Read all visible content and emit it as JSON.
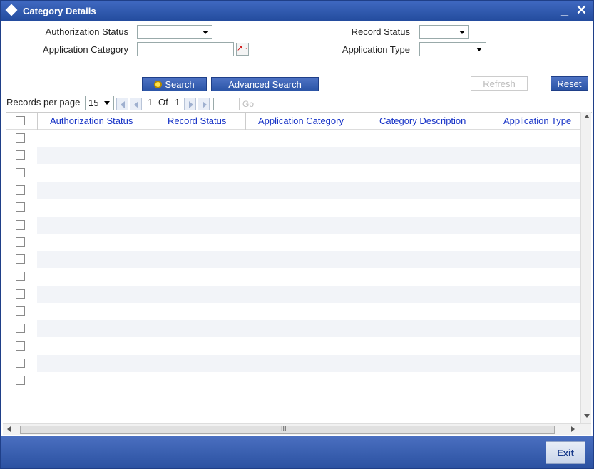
{
  "window": {
    "title": "Category Details",
    "minimize_glyph": "_",
    "close_glyph": "✕"
  },
  "form": {
    "authorization_status": {
      "label": "Authorization Status",
      "value": ""
    },
    "application_category": {
      "label": "Application Category",
      "value": ""
    },
    "record_status": {
      "label": "Record Status",
      "value": ""
    },
    "application_type": {
      "label": "Application Type",
      "value": ""
    }
  },
  "actions": {
    "search": "Search",
    "advanced_search": "Advanced Search",
    "refresh": "Refresh",
    "reset": "Reset"
  },
  "pager": {
    "records_per_page_label": "Records per page",
    "records_per_page": "15",
    "page": "1",
    "of_label": "Of",
    "total_pages": "1",
    "go": "Go"
  },
  "grid": {
    "columns": [
      "Authorization Status",
      "Record Status",
      "Application Category",
      "Category Description",
      "Application Type"
    ],
    "row_count": 15
  },
  "hscroll_glyph": "III",
  "footer": {
    "exit": "Exit"
  },
  "colors": {
    "accent": "#2c52a2",
    "header_text": "#1733c7"
  },
  "icons": [
    "search-icon",
    "lov-icon",
    "first-page-icon",
    "prev-page-icon",
    "next-page-icon",
    "last-page-icon"
  ]
}
